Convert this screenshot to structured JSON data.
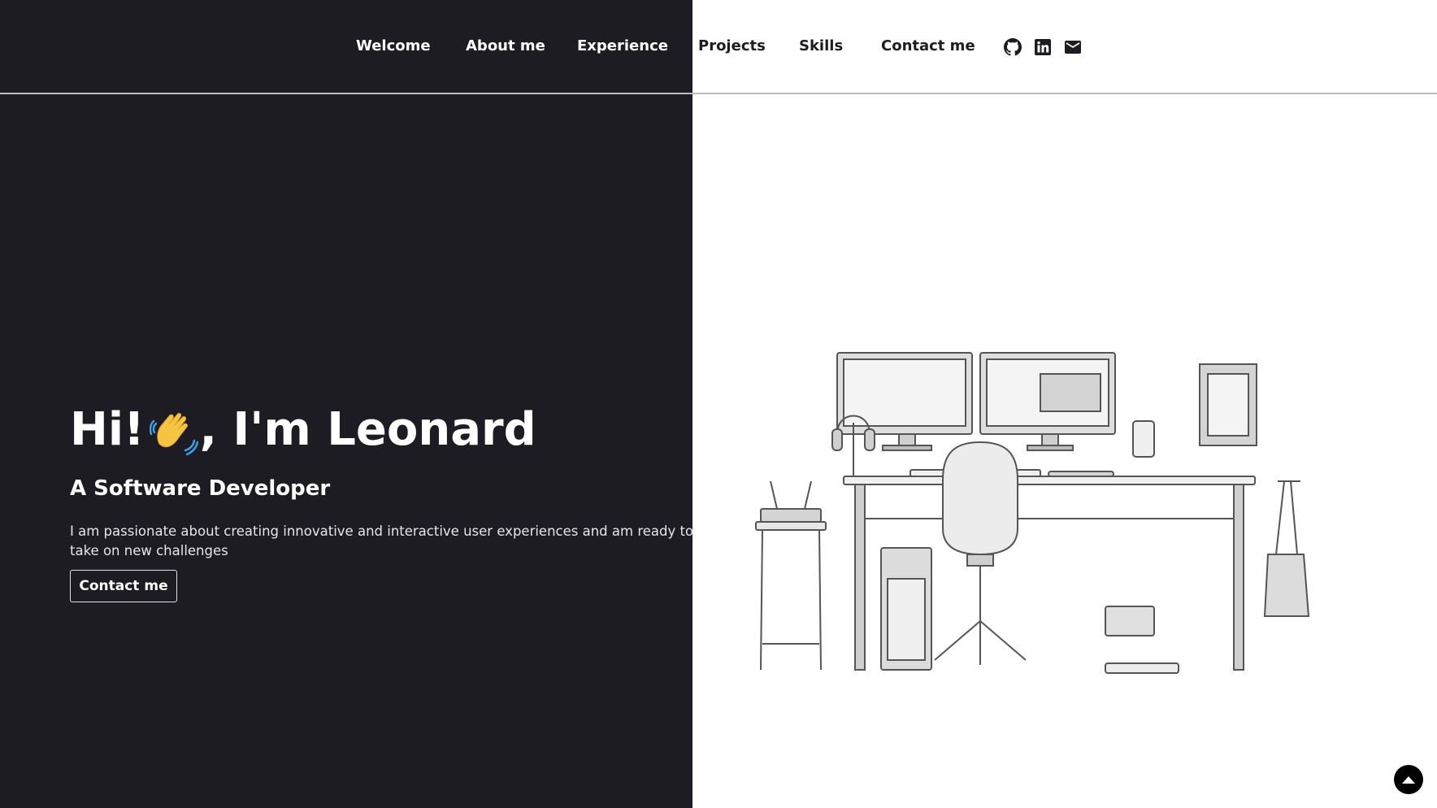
{
  "nav": {
    "links": [
      {
        "label": "Welcome"
      },
      {
        "label": "About me"
      },
      {
        "label": "Experience"
      },
      {
        "label": "Projects"
      },
      {
        "label": "Skills"
      },
      {
        "label": "Contact me"
      }
    ],
    "icons": [
      "github-icon",
      "linkedin-icon",
      "email-icon"
    ]
  },
  "hero": {
    "title_prefix": "Hi!",
    "title_suffix": ", I'm Leonard",
    "subtitle": "A Software Developer",
    "description": "I am passionate about creating innovative and interactive user experiences and am ready to take on new challenges",
    "cta_label": "Contact me"
  },
  "colors": {
    "dark_panel": "#1d1c22",
    "light_panel": "#ffffff",
    "accent": "#000000"
  },
  "icons": {
    "wave": "waving-hand-icon",
    "illustration": "developer-desk-illustration",
    "scroll_top": "scroll-to-top-icon"
  }
}
